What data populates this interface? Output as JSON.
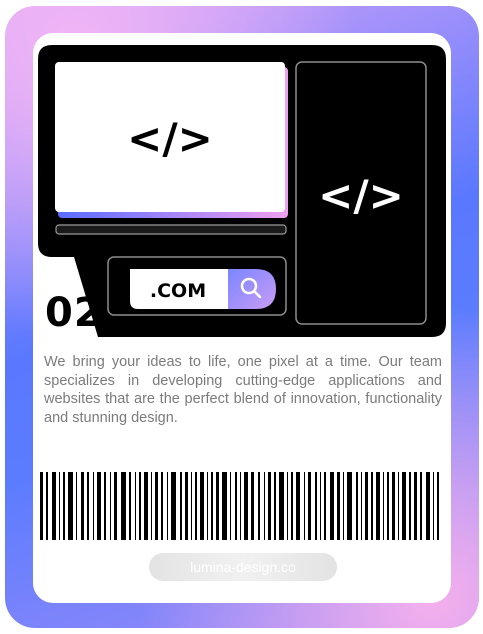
{
  "card": {
    "number": "02",
    "description": "We bring your ideas to life, one pixel at a time. Our team specializes in developing cutting-edge applications and websites that are the perfect blend of innovation, functionality and stunning design.",
    "website": "lumina-design.co"
  },
  "illustration": {
    "code_symbol_left": "</>",
    "code_symbol_right": "</>",
    "domain_label": ".COM",
    "search_icon": "search-icon"
  },
  "colors": {
    "frame_gradient": [
      "#f2b6f5",
      "#5a78ff",
      "#f5b0ec"
    ],
    "accent_blue": "#5a6cff",
    "accent_pink": "#f0a0f0",
    "ink": "#000000",
    "text_gray": "#7b7b7b"
  }
}
